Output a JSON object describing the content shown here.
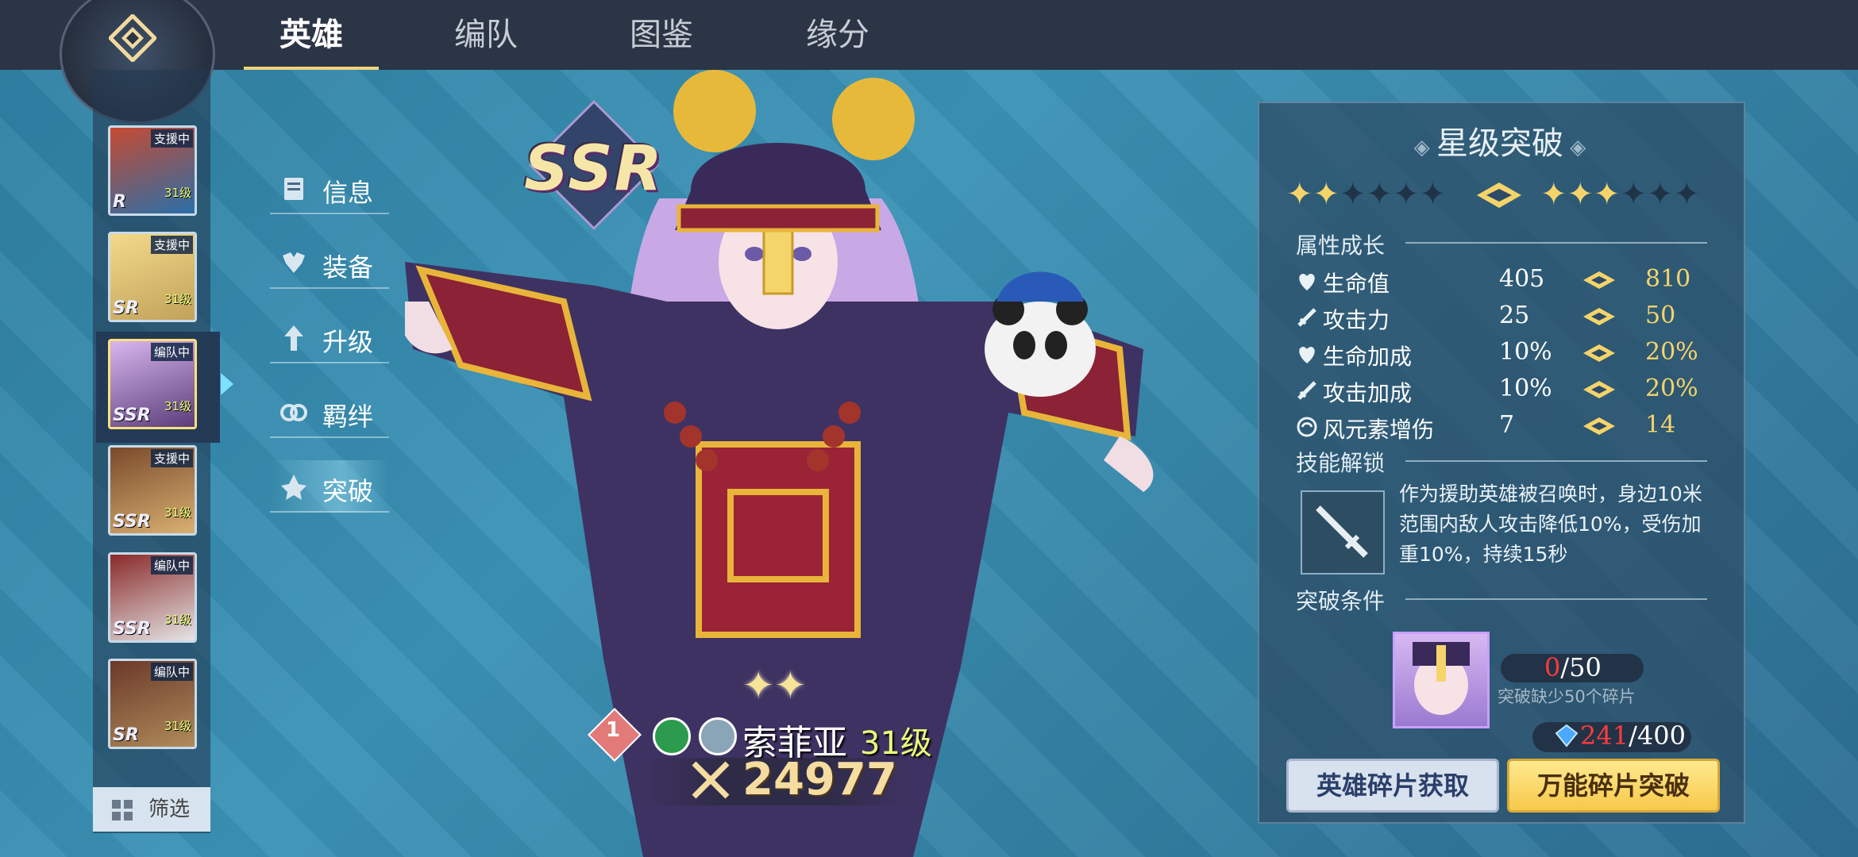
{
  "tabs": [
    {
      "label": "英雄",
      "active": true
    },
    {
      "label": "编队",
      "active": false
    },
    {
      "label": "图鉴",
      "active": false
    },
    {
      "label": "缘分",
      "active": false
    }
  ],
  "roster": [
    {
      "status": "支援中",
      "rarity": "R",
      "level": "31级",
      "colors": [
        "#c64a32",
        "#2a6fa8"
      ]
    },
    {
      "status": "支援中",
      "rarity": "SR",
      "level": "31级",
      "colors": [
        "#f3d98a",
        "#c2a25a"
      ]
    },
    {
      "status": "编队中",
      "rarity": "SSR",
      "level": "31级",
      "colors": [
        "#d8b6ee",
        "#5a3d7a"
      ],
      "selected": true
    },
    {
      "status": "支援中",
      "rarity": "SSR",
      "level": "31级",
      "colors": [
        "#7a4a2a",
        "#d9b073"
      ]
    },
    {
      "status": "编队中",
      "rarity": "SSR",
      "level": "31级",
      "colors": [
        "#8a2a2a",
        "#e4e4e4"
      ]
    },
    {
      "status": "编队中",
      "rarity": "SR",
      "level": "31级",
      "colors": [
        "#6a3a2a",
        "#b08a5a"
      ]
    }
  ],
  "filter_label": "筛选",
  "side_menu": [
    {
      "label": "信息",
      "icon": "book-icon"
    },
    {
      "label": "装备",
      "icon": "armor-icon"
    },
    {
      "label": "升级",
      "icon": "level-up-icon"
    },
    {
      "label": "羁绊",
      "icon": "bond-icon"
    },
    {
      "label": "突破",
      "icon": "breakthrough-icon",
      "active": true
    }
  ],
  "hero": {
    "rarity": "SSR",
    "rank": "1",
    "name": "索菲亚",
    "level": "31级",
    "power": "24977"
  },
  "panel": {
    "title": "星级突破",
    "current_stars": {
      "filled": 2,
      "total": 6
    },
    "next_stars": {
      "filled": 3,
      "total": 6
    },
    "attr_section": "属性成长",
    "stats": [
      {
        "name": "生命值",
        "icon": "heart-icon",
        "current": "405",
        "next": "810"
      },
      {
        "name": "攻击力",
        "icon": "sword-icon",
        "current": "25",
        "next": "50"
      },
      {
        "name": "生命加成",
        "icon": "heart-icon",
        "current": "10%",
        "next": "20%"
      },
      {
        "name": "攻击加成",
        "icon": "sword-icon",
        "current": "10%",
        "next": "20%"
      },
      {
        "name": "风元素增伤",
        "icon": "wind-icon",
        "current": "7",
        "next": "14"
      }
    ],
    "skill_section": "技能解锁",
    "skill_desc": "作为援助英雄被召唤时，身边10米范围内敌人攻击降低10%，受伤加重10%，持续15秒",
    "cond_section": "突破条件",
    "shard_have": "0",
    "shard_need": "/50",
    "shard_note": "突破缺少50个碎片",
    "universal_have": "241",
    "universal_need": "/400",
    "btn_hero_shard": "英雄碎片获取",
    "btn_universal": "万能碎片突破"
  },
  "colors": {
    "accent_gold": "#f4d46a",
    "deficit_red": "#ff3b3b",
    "level_green": "#e9ff7a"
  }
}
